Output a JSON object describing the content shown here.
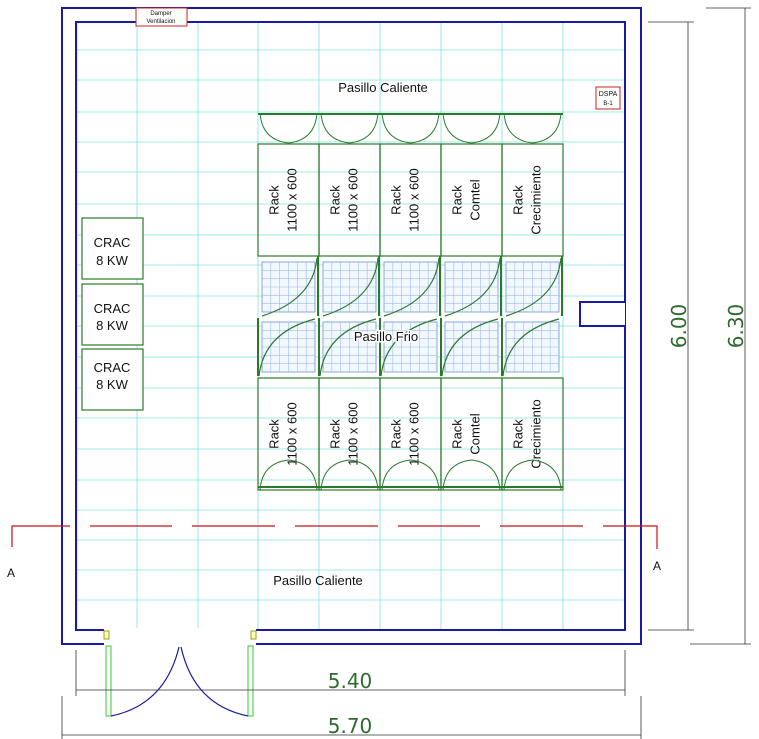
{
  "room": {
    "hot_aisle_top": "Pasillo Caliente",
    "hot_aisle_bottom": "Pasillo Caliente",
    "cold_aisle": "Pasillo Frio",
    "damper_line1": "Damper",
    "damper_line2": "Ventilacion",
    "dspa_line1": "DSPA",
    "dspa_line2": "B-1"
  },
  "crac_units": [
    {
      "line1": "CRAC",
      "line2": "8 KW"
    },
    {
      "line1": "CRAC",
      "line2": "8 KW"
    },
    {
      "line1": "CRAC",
      "line2": "8 KW"
    }
  ],
  "racks_top": [
    {
      "line1": "Rack",
      "line2": "1100 x 600"
    },
    {
      "line1": "Rack",
      "line2": "1100 x 600"
    },
    {
      "line1": "Rack",
      "line2": "1100 x 600"
    },
    {
      "line1": "Rack",
      "line2": "Comtel"
    },
    {
      "line1": "Rack",
      "line2": "Crecimiento"
    }
  ],
  "racks_bottom": [
    {
      "line1": "Rack",
      "line2": "1100 x 600"
    },
    {
      "line1": "Rack",
      "line2": "1100 x 600"
    },
    {
      "line1": "Rack",
      "line2": "1100 x 600"
    },
    {
      "line1": "Rack",
      "line2": "Comtel"
    },
    {
      "line1": "Rack",
      "line2": "Crecimiento"
    }
  ],
  "section": {
    "left": "A",
    "right": "A"
  },
  "dimensions": {
    "inner_height": "6.00",
    "outer_height": "6.30",
    "inner_width": "5.40",
    "outer_width": "5.70"
  },
  "colors": {
    "wall": "#1a1aa8",
    "grid": "#7fe3e3",
    "equipment": "#2b7a2b",
    "section_line": "#cc1111",
    "label_box": "#cc2222"
  }
}
